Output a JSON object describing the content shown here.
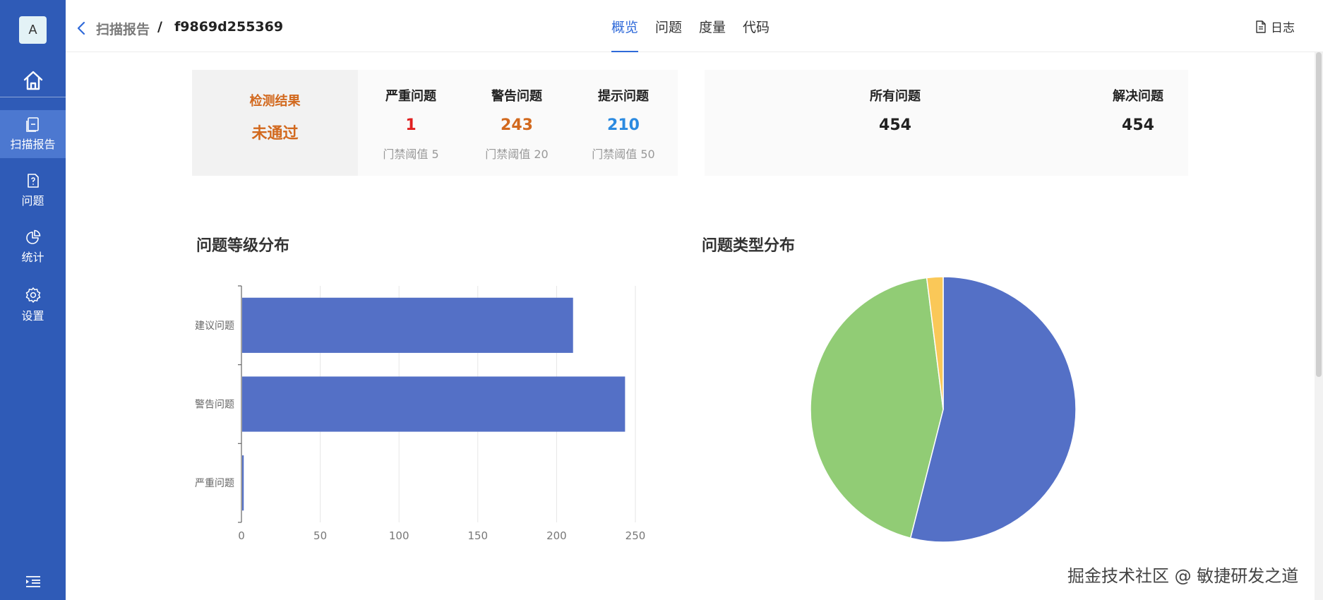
{
  "sidebar": {
    "avatar": "A",
    "items": [
      {
        "label": "扫描报告",
        "icon": "report-icon",
        "active": true
      },
      {
        "label": "问题",
        "icon": "issue-file-icon",
        "active": false
      },
      {
        "label": "统计",
        "icon": "pie-chart-icon",
        "active": false
      },
      {
        "label": "设置",
        "icon": "gear-icon",
        "active": false
      }
    ]
  },
  "header": {
    "breadcrumb_parent": "扫描报告",
    "breadcrumb_sep": "/",
    "breadcrumb_current": "f9869d255369",
    "tabs": [
      {
        "label": "概览",
        "active": true
      },
      {
        "label": "问题",
        "active": false
      },
      {
        "label": "度量",
        "active": false
      },
      {
        "label": "代码",
        "active": false
      }
    ],
    "log_label": "日志"
  },
  "summary": {
    "result_title": "检测结果",
    "result_value": "未通过",
    "stats": [
      {
        "title": "严重问题",
        "value": "1",
        "threshold": "门禁阈值 5",
        "color": "#e02020"
      },
      {
        "title": "警告问题",
        "value": "243",
        "threshold": "门禁阈值 20",
        "color": "#d2691e"
      },
      {
        "title": "提示问题",
        "value": "210",
        "threshold": "门禁阈值 50",
        "color": "#2b8ae0"
      }
    ],
    "totals": [
      {
        "title": "所有问题",
        "value": "454"
      },
      {
        "title": "解决问题",
        "value": "454"
      }
    ]
  },
  "sections": {
    "level_title": "问题等级分布",
    "type_title": "问题类型分布"
  },
  "chart_data": [
    {
      "type": "bar",
      "orientation": "horizontal",
      "categories": [
        "建议问题",
        "警告问题",
        "严重问题"
      ],
      "values": [
        210,
        243,
        1
      ],
      "xlim": [
        0,
        250
      ],
      "xticks": [
        0,
        50,
        100,
        150,
        200,
        250
      ],
      "grid": true,
      "color": "#5470c6"
    },
    {
      "type": "pie",
      "values": [
        245,
        200,
        9
      ],
      "colors": [
        "#5470c6",
        "#91cc75",
        "#fac858"
      ]
    }
  ],
  "watermark": "掘金技术社区 @ 敏捷研发之道"
}
